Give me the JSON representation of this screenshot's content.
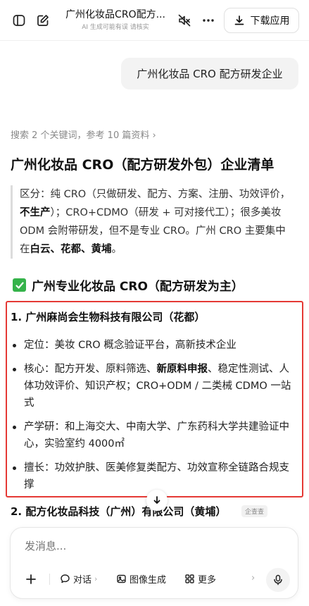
{
  "header": {
    "title": "广州化妆品CRO配方...",
    "subtitle": "AI 生成可能有误 请核实",
    "download_label": "下载应用"
  },
  "user_message": "广州化妆品 CRO 配方研发企业",
  "answer": {
    "search_meta": "搜索 2 个关键词，参考 10 篇资料",
    "search_meta_chevron": "›",
    "title": "广州化妆品 CRO（配方研发外包）企业清单",
    "note": {
      "p1": "区分：纯 CRO（只做研发、配方、方案、注册、功效评价，",
      "b1": "不生产",
      "p2": "）；CRO+CDMO（研发 + 可对接代工）；很多美妆 ODM 会附带研发，但不是专业 CRO。广州 CRO 主要集中在",
      "b2": "白云、花都、黄埔",
      "p3": "。"
    },
    "section_title": "广州专业化妆品 CRO（配方研发为主）",
    "company1": {
      "title": "1. 广州麻尚会生物科技有限公司（花都）",
      "bullets": [
        {
          "pre": "定位：美妆 CRO 概念验证平台，高新技术企业",
          "bold": "",
          "post": ""
        },
        {
          "pre": "核心：配方开发、原料筛选、",
          "bold": "新原料申报",
          "post": "、稳定性测试、人体功效评价、知识产权；CRO+ODM / 二类械 CDMO 一站式"
        },
        {
          "pre": "产学研：和上海交大、中南大学、广东药科大学共建验证中心，实验室约 4000㎡",
          "bold": "",
          "post": ""
        },
        {
          "pre": "擅长：功效护肤、医美修复类配方、功效宣称全链路合规支撑",
          "bold": "",
          "post": ""
        }
      ]
    },
    "company2": {
      "title": "2. 配方化妆品科技（广州）有限公司（黄埔）",
      "badge": "企查查"
    }
  },
  "composer": {
    "placeholder": "发消息...",
    "tools": [
      {
        "label": "对话",
        "chevron": "›"
      },
      {
        "label": "图像生成",
        "chevron": ""
      },
      {
        "label": "更多",
        "chevron": ""
      }
    ],
    "more_chevron": "›"
  },
  "icons": {
    "sidebar": "sidebar-toggle-icon",
    "new_chat": "new-chat-icon",
    "mute": "speaker-muted-icon",
    "more": "more-dots-icon",
    "download": "download-icon",
    "check": "check-mark-icon",
    "arrow_down": "arrow-down-icon",
    "plus": "plus-icon",
    "chat": "chat-bubble-icon",
    "image": "image-icon",
    "grid": "grid-icon",
    "mic": "microphone-icon"
  },
  "colors": {
    "highlight_border": "#e53935",
    "check_green": "#35b34a",
    "bubble_bg": "#f3f3f3"
  }
}
